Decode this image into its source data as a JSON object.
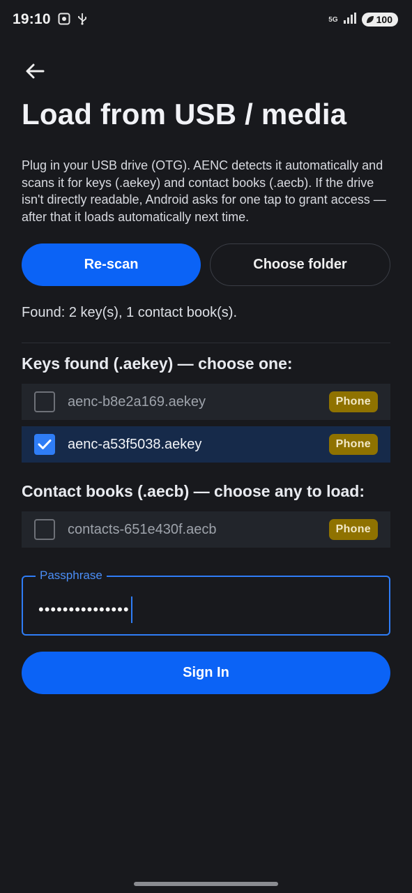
{
  "status_bar": {
    "time": "19:10",
    "network": "5G",
    "battery": "100"
  },
  "header": {
    "title": "Load from USB / media"
  },
  "description": "Plug in your USB drive (OTG). AENC detects it automatically and scans it for keys (.aekey) and contact books (.aecb). If the drive isn't directly readable, Android asks for one tap to grant access — after that it loads automatically next time.",
  "actions": {
    "rescan_label": "Re-scan",
    "choose_folder_label": "Choose folder"
  },
  "found_summary": "Found: 2 key(s), 1 contact book(s).",
  "keys_section": {
    "title": "Keys found (.aekey) — choose one:",
    "items": [
      {
        "name": "aenc-b8e2a169.aekey",
        "badge": "Phone",
        "checked": false
      },
      {
        "name": "aenc-a53f5038.aekey",
        "badge": "Phone",
        "checked": true
      }
    ]
  },
  "contacts_section": {
    "title": "Contact books (.aecb) — choose any to load:",
    "items": [
      {
        "name": "contacts-651e430f.aecb",
        "badge": "Phone",
        "checked": false
      }
    ]
  },
  "passphrase": {
    "label": "Passphrase",
    "value": "•••••••••••••••"
  },
  "sign_in_label": "Sign In",
  "colors": {
    "background": "#18191d",
    "accent": "#0b63f6",
    "badge": "#8f7200"
  }
}
